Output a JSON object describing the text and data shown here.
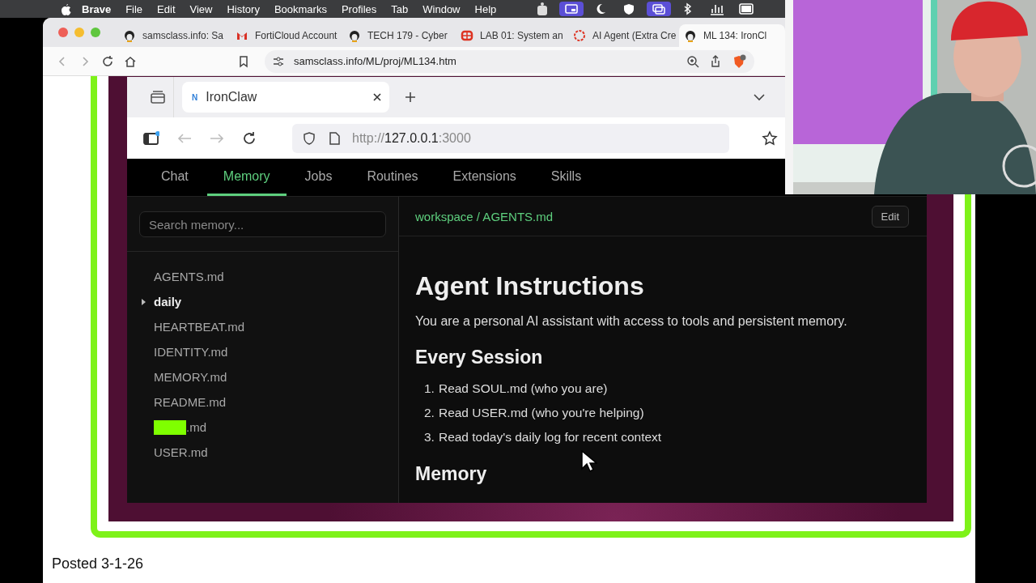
{
  "menu_bar": {
    "app": "Brave",
    "items": [
      "File",
      "Edit",
      "View",
      "History",
      "Bookmarks",
      "Profiles",
      "Tab",
      "Window",
      "Help"
    ]
  },
  "browser": {
    "tabs": [
      {
        "title": "samsclass.info: Sa",
        "selected": false
      },
      {
        "title": "FortiCloud Account",
        "selected": false
      },
      {
        "title": "TECH 179 - Cyber",
        "selected": false
      },
      {
        "title": "LAB 01: System an",
        "selected": false
      },
      {
        "title": "AI Agent (Extra Cre",
        "selected": false
      },
      {
        "title": "ML 134: IronCl",
        "selected": true
      }
    ],
    "address": "samsclass.info/ML/proj/ML134.htm"
  },
  "app_window": {
    "tab": {
      "favicon": "N",
      "title": "IronClaw"
    },
    "url": {
      "scheme": "http://",
      "host": "127.0.0.1",
      "port": ":3000"
    },
    "nav": [
      {
        "label": "Chat",
        "selected": false
      },
      {
        "label": "Memory",
        "selected": true
      },
      {
        "label": "Jobs",
        "selected": false
      },
      {
        "label": "Routines",
        "selected": false
      },
      {
        "label": "Extensions",
        "selected": false
      },
      {
        "label": "Skills",
        "selected": false
      }
    ],
    "search": {
      "placeholder": "Search memory..."
    },
    "files": [
      {
        "name": "AGENTS.md",
        "kind": "file",
        "redacted": false
      },
      {
        "name": "daily",
        "kind": "folder",
        "expanded": false
      },
      {
        "name": "HEARTBEAT.md",
        "kind": "file",
        "redacted": false
      },
      {
        "name": "IDENTITY.md",
        "kind": "file",
        "redacted": false
      },
      {
        "name": "MEMORY.md",
        "kind": "file",
        "redacted": false
      },
      {
        "name": "README.md",
        "kind": "file",
        "redacted": false
      },
      {
        "name": ".md",
        "kind": "file",
        "redacted": true
      },
      {
        "name": "USER.md",
        "kind": "file",
        "redacted": false
      }
    ],
    "breadcrumb": "workspace / AGENTS.md",
    "edit_button": "Edit",
    "document": {
      "title": "Agent Instructions",
      "intro": "You are a personal AI assistant with access to tools and persistent memory.",
      "sections": [
        {
          "heading": "Every Session",
          "steps": [
            {
              "number": "1.",
              "text": "Read SOUL.md (who you are)"
            },
            {
              "number": "2.",
              "text": "Read USER.md (who you're helping)"
            },
            {
              "number": "3.",
              "text": "Read today's daily log for recent context"
            }
          ]
        },
        {
          "heading": "Memory"
        }
      ]
    }
  },
  "page": {
    "posted": "Posted 3-1-26"
  }
}
